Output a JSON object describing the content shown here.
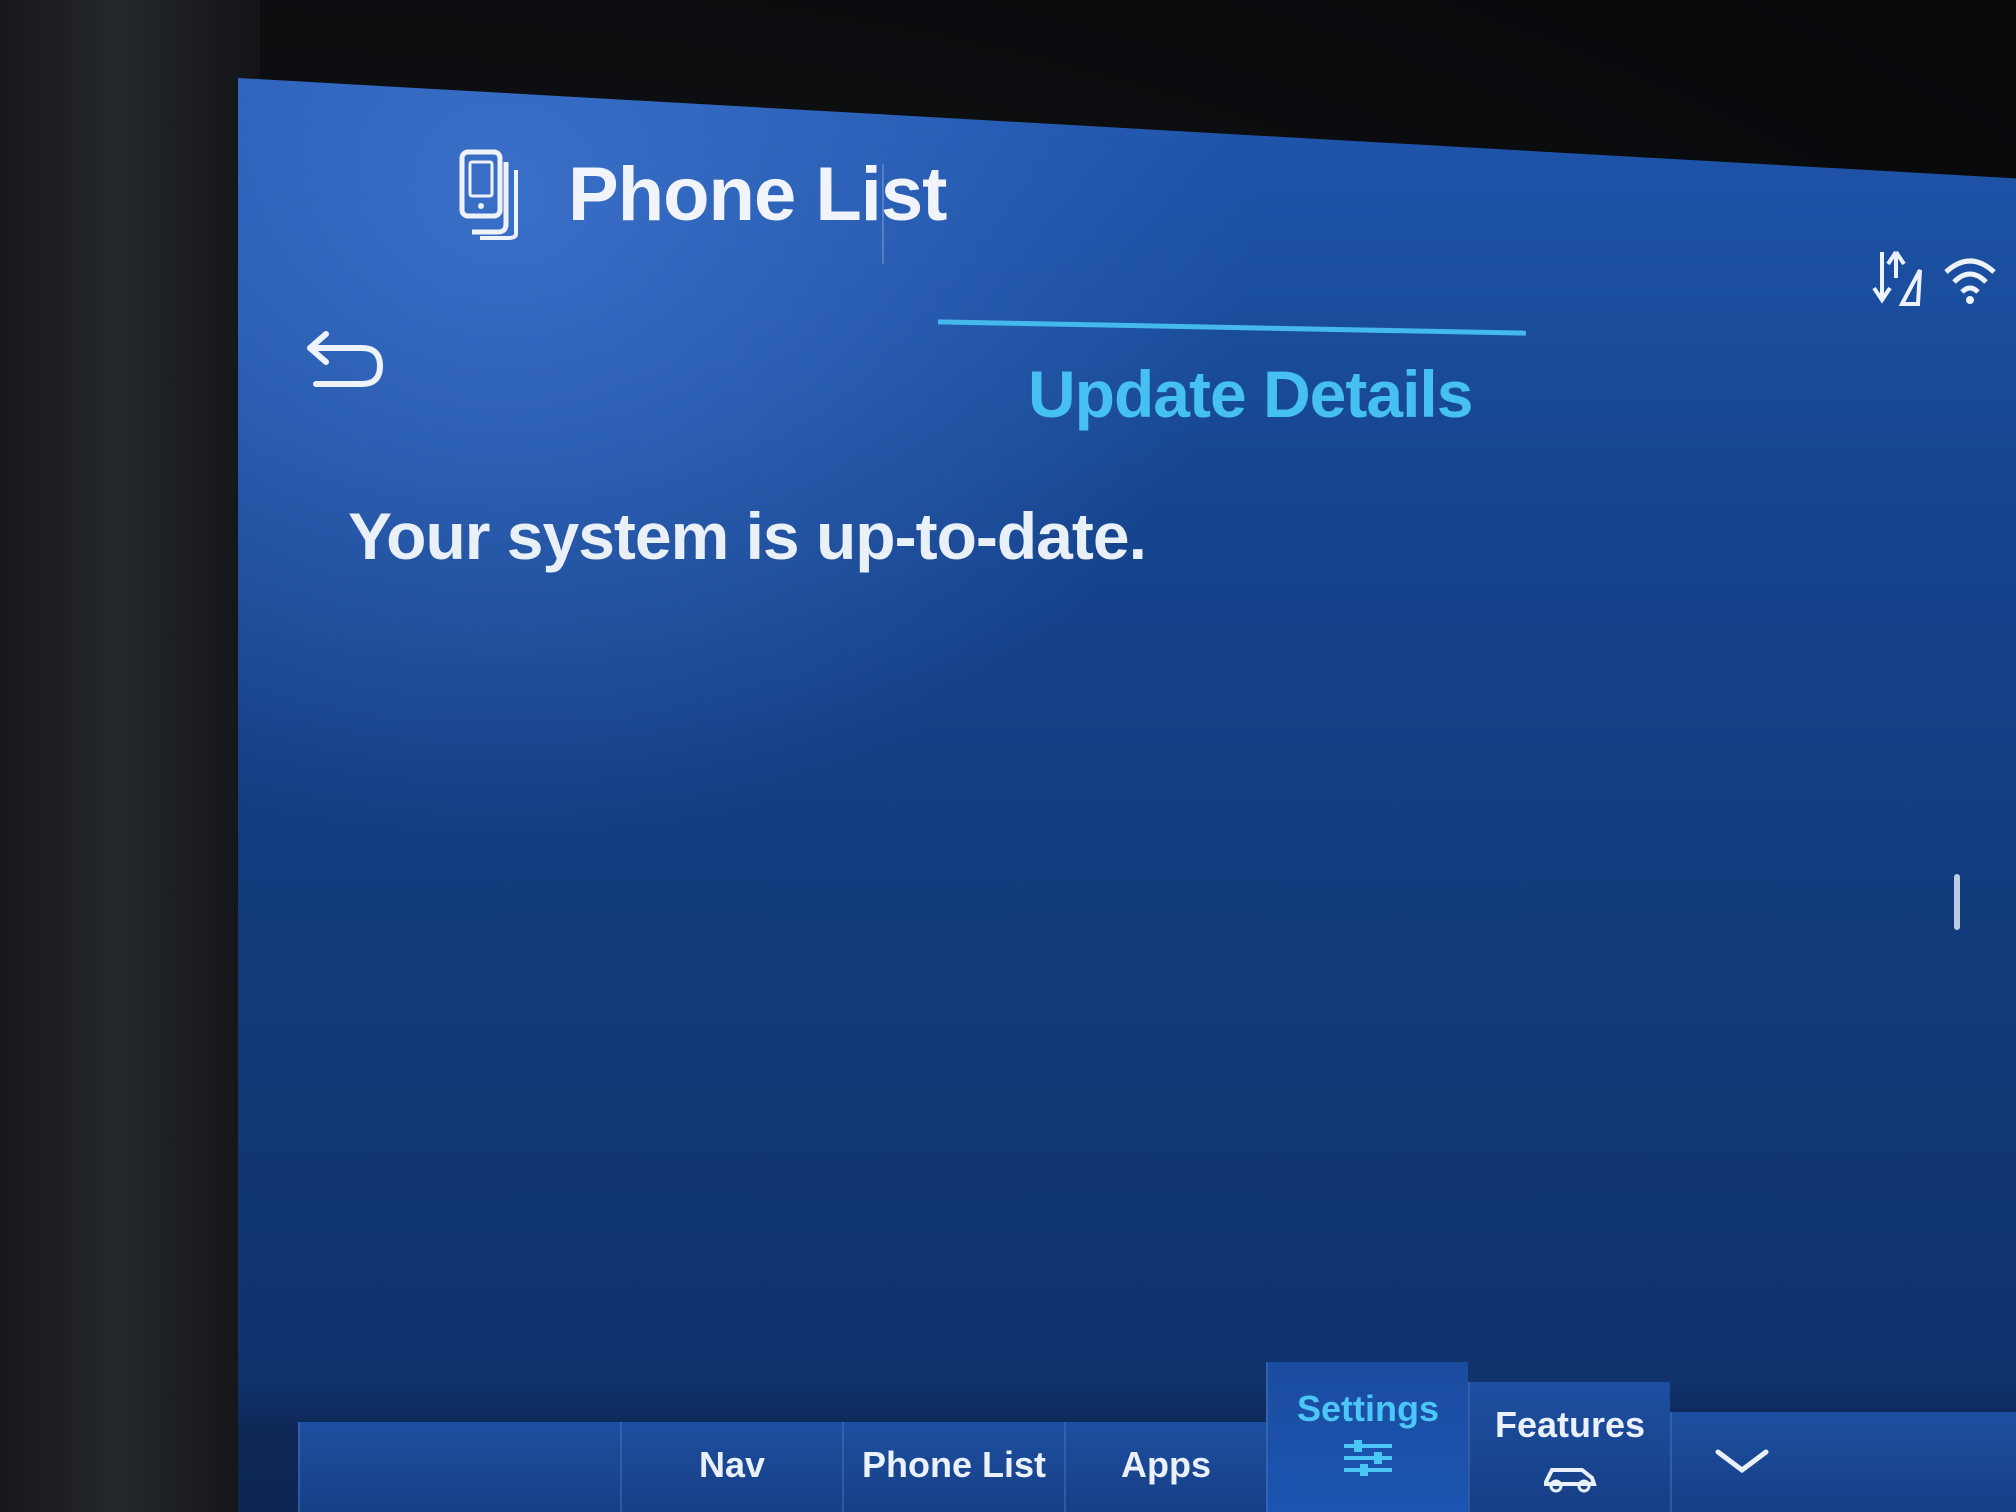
{
  "header": {
    "app_title": "Phone List",
    "app_icon": "phone-list-icon",
    "status_icons": [
      "gps-signal-icon",
      "wifi-icon"
    ]
  },
  "navigation": {
    "back_icon": "back-arrow-icon"
  },
  "tab": {
    "label": "Update Details"
  },
  "content": {
    "message": "Your system is up-to-date."
  },
  "bottom_nav": {
    "items": [
      {
        "label": ""
      },
      {
        "label": "Nav"
      },
      {
        "label": "Phone List"
      },
      {
        "label": "Apps"
      },
      {
        "label": "Settings",
        "icon": "sliders-icon",
        "active": true
      },
      {
        "label": "Features",
        "icon": "vehicle-icon"
      },
      {
        "label": "",
        "icon": "chevron-down-icon"
      }
    ]
  },
  "colors": {
    "accent": "#46c0f3",
    "screen_background": "#1f56ad",
    "text": "#e9f0f8"
  }
}
